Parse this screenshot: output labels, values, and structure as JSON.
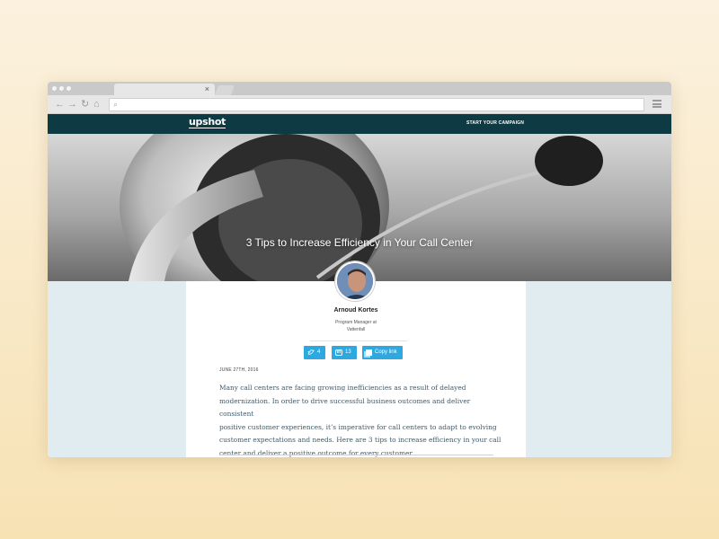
{
  "browser": {
    "tab_close": "×",
    "nav": {
      "back": "←",
      "forward": "→",
      "reload": "↻",
      "home": "⌂"
    },
    "search_icon": "⌕",
    "icons": [
      "back-icon",
      "forward-icon",
      "reload-icon",
      "home-icon",
      "search-icon",
      "menu-icon",
      "close-icon"
    ]
  },
  "site": {
    "logo": "upshot",
    "cta": "START YOUR CAMPAIGN"
  },
  "hero": {
    "title": "3 Tips to Increase Efficiency in Your Call Center"
  },
  "author": {
    "name": "Arnoud Kortes",
    "role_line1": "Program Manager at",
    "role_line2": "Vattenfall"
  },
  "share": {
    "twitter_count": "4",
    "linkedin_icon": "in",
    "linkedin_count": "13",
    "copy_label": "Copy link"
  },
  "article": {
    "date": "JUNE 27TH, 2016",
    "lines": [
      "Many call centers are facing growing inefficiencies as a result of delayed",
      "modernization. In order to drive successful business outcomes and deliver consistent",
      "positive customer experiences, it’s imperative for call centers to adapt to evolving",
      "customer expectations and needs. Here are 3 tips to increase efficiency in your call",
      "center and deliver a positive outcome for every customer."
    ]
  },
  "colors": {
    "header_bg": "#0e3a43",
    "share_button": "#2fa8e0",
    "side_panel": "#e1ecf1",
    "body_text": "#3f5a6b"
  }
}
